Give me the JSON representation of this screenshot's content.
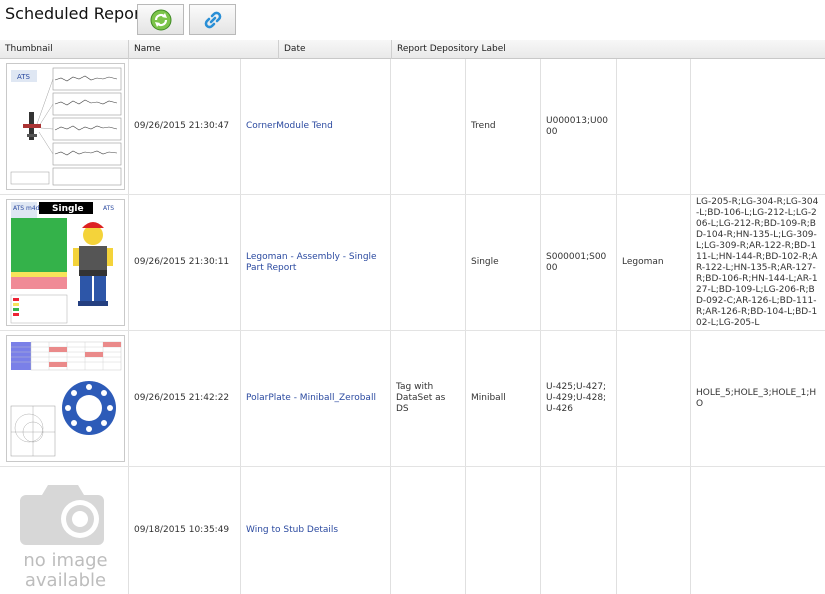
{
  "header": {
    "title": "Scheduled Reports",
    "refresh_icon": "refresh-icon",
    "link_icon": "link-icon"
  },
  "columns": [
    "Thumbnail",
    "Name",
    "Date",
    "Report Depository Label"
  ],
  "rows": [
    {
      "date": "09/26/2015 21:30:47",
      "name": "CornerModule Tend",
      "label": "",
      "template": "Trend",
      "parts": "U000013;U0000",
      "model": "",
      "features": ""
    },
    {
      "date": "09/26/2015 21:30:11",
      "name": "Legoman - Assembly - Single Part Report",
      "label": "",
      "template": "Single",
      "parts": "S000001;S0000",
      "model": "Legoman",
      "features": "LG-205-R;LG-304-R;LG-304-L;BD-106-L;LG-212-L;LG-206-L;LG-212-R;BD-109-R;BD-104-R;HN-135-L;LG-309-L;LG-309-R;AR-122-R;BD-111-L;HN-144-R;BD-102-R;AR-122-L;HN-135-R;AR-127-R;BD-106-R;HN-144-L;AR-127-L;BD-109-L;LG-206-R;BD-092-C;AR-126-L;BD-111-R;AR-126-R;BD-104-L;BD-102-L;LG-205-L"
    },
    {
      "date": "09/26/2015 21:42:22",
      "name": "PolarPlate - Miniball_Zeroball",
      "label": "Tag with DataSet as DS",
      "template": "Miniball",
      "parts": "U-425;U-427;U-429;U-428;U-426",
      "model": "",
      "features": "HOLE_5;HOLE_3;HOLE_1;HO"
    },
    {
      "date": "09/18/2015 10:35:49",
      "name": "Wing to Stub Details",
      "label": "",
      "template": "",
      "parts": "",
      "model": "",
      "features": ""
    }
  ],
  "thumbnails": {
    "trend_logo": "ATS",
    "single_title": "Single",
    "single_logo": "ATS m4d",
    "single_logo_right": "ATS",
    "no_image_line1": "no image",
    "no_image_line2": "available"
  },
  "colors": {
    "link": "#2b4aa0",
    "green": "#34b24a",
    "red_pink": "#f08a96",
    "blue": "#2d6fc8",
    "yellow": "#f7e35a"
  }
}
